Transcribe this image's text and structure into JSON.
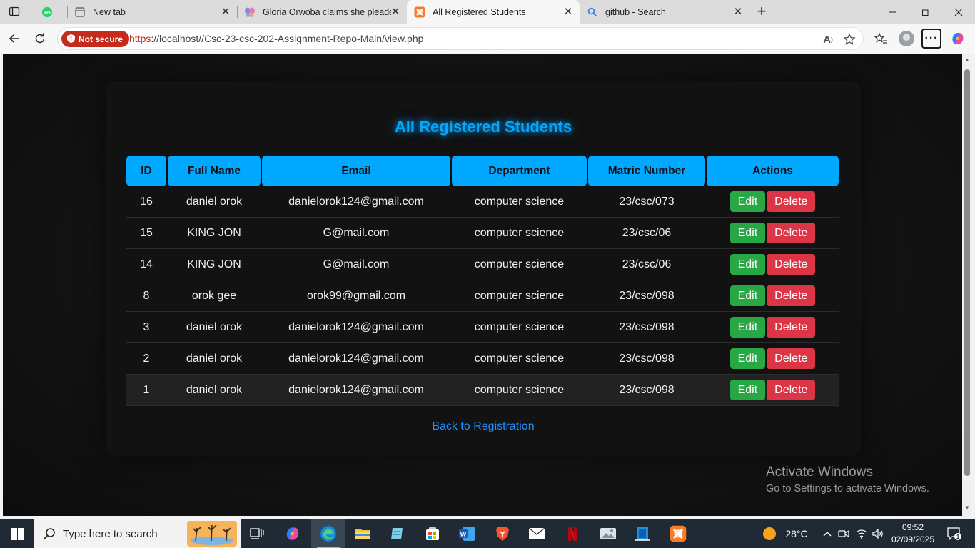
{
  "browser": {
    "tabs": [
      {
        "title": "",
        "icon": "whatsapp-badge-icon",
        "badge": "99+"
      },
      {
        "title": "New tab",
        "icon": "new-tab-page-icon"
      },
      {
        "title": "Gloria Orwoba claims she pleaded",
        "icon": "butterfly-icon"
      },
      {
        "title": "All Registered Students",
        "icon": "xampp-icon",
        "active": true
      },
      {
        "title": "github - Search",
        "icon": "search-icon"
      }
    ],
    "security_label": "Not secure",
    "url_scheme": "https",
    "url_rest": "://localhost//Csc-23-csc-202-Assignment-Repo-Main/view.php"
  },
  "page": {
    "title": "All Registered Students",
    "columns": [
      "ID",
      "Full Name",
      "Email",
      "Department",
      "Matric Number",
      "Actions"
    ],
    "rows": [
      {
        "id": "16",
        "name": "daniel orok",
        "email": "danielorok124@gmail.com",
        "department": "computer science",
        "matric": "23/csc/073"
      },
      {
        "id": "15",
        "name": "KING JON",
        "email": "G@mail.com",
        "department": "computer science",
        "matric": "23/csc/06"
      },
      {
        "id": "14",
        "name": "KING JON",
        "email": "G@mail.com",
        "department": "computer science",
        "matric": "23/csc/06"
      },
      {
        "id": "8",
        "name": "orok gee",
        "email": "orok99@gmail.com",
        "department": "computer science",
        "matric": "23/csc/098"
      },
      {
        "id": "3",
        "name": "daniel orok",
        "email": "danielorok124@gmail.com",
        "department": "computer science",
        "matric": "23/csc/098"
      },
      {
        "id": "2",
        "name": "daniel orok",
        "email": "danielorok124@gmail.com",
        "department": "computer science",
        "matric": "23/csc/098"
      },
      {
        "id": "1",
        "name": "daniel orok",
        "email": "danielorok124@gmail.com",
        "department": "computer science",
        "matric": "23/csc/098"
      }
    ],
    "edit_label": "Edit",
    "delete_label": "Delete",
    "back_link": "Back to Registration",
    "accent_color": "#00a8ff",
    "edit_color": "#28a745",
    "delete_color": "#dc3545"
  },
  "watermark": {
    "line1": "Activate Windows",
    "line2": "Go to Settings to activate Windows."
  },
  "taskbar": {
    "search_placeholder": "Type here to search",
    "weather_temp": "28°C",
    "time": "09:52",
    "date": "02/09/2025",
    "notification_count": "1"
  }
}
